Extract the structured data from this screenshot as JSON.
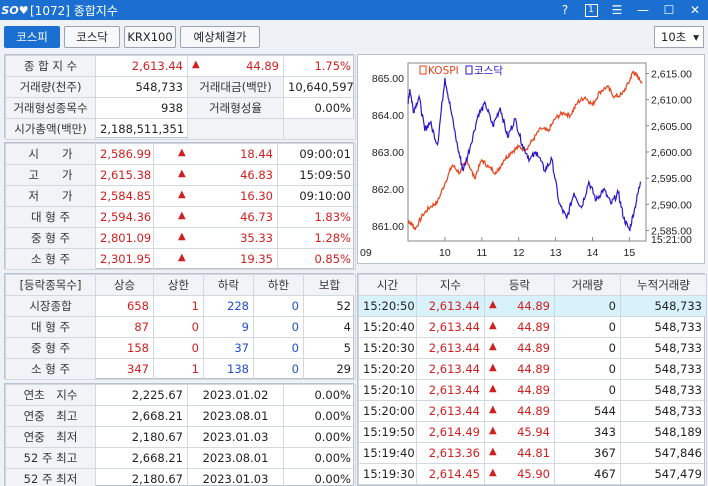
{
  "window": {
    "logo": "SO♥",
    "title": "[1072] 종합지수",
    "help": "?",
    "num_btn": "1",
    "menu": "☰",
    "minimize": "—",
    "maximize": "☐",
    "close": "✕"
  },
  "tabs": [
    "코스피",
    "코스닥",
    "KRX100",
    "예상체결가"
  ],
  "interval": "10초",
  "summary": {
    "index_label": "종 합 지 수",
    "index_value": "2,613.44",
    "index_change": "44.89",
    "index_rate": "1.75%",
    "volume_label": "거래량(천주)",
    "volume": "548,733",
    "amount_label": "거래대금(백만)",
    "amount": "10,640,597",
    "formed_count_label": "거래형성종목수",
    "formed_count": "938",
    "formed_rate_label": "거래형성율",
    "formed_rate": "0.00%",
    "mktcap_label": "시가총액(백만)",
    "mktcap": "2,188,511,351"
  },
  "prices": [
    {
      "label": "시　　가",
      "value": "2,586.99",
      "change": "18.44",
      "extra": "09:00:01",
      "extra_red": false
    },
    {
      "label": "고　　가",
      "value": "2,615.38",
      "change": "46.83",
      "extra": "15:09:50",
      "extra_red": false
    },
    {
      "label": "저　　가",
      "value": "2,584.85",
      "change": "16.30",
      "extra": "09:10:00",
      "extra_red": false
    },
    {
      "label": "대 형 주",
      "value": "2,594.36",
      "change": "46.73",
      "extra": "1.83%",
      "extra_red": true
    },
    {
      "label": "중 형 주",
      "value": "2,801.09",
      "change": "35.33",
      "extra": "1.28%",
      "extra_red": true
    },
    {
      "label": "소 형 주",
      "value": "2,301.95",
      "change": "19.35",
      "extra": "0.85%",
      "extra_red": true
    }
  ],
  "updown": {
    "headers": [
      "[등락종목수]",
      "상승",
      "상한",
      "하락",
      "하한",
      "보합"
    ],
    "rows": [
      {
        "label": "시장종합",
        "up": "658",
        "upper": "1",
        "down": "228",
        "lower": "0",
        "flat": "52"
      },
      {
        "label": "대 형 주",
        "up": "87",
        "upper": "0",
        "down": "9",
        "lower": "0",
        "flat": "4"
      },
      {
        "label": "중 형 주",
        "up": "158",
        "upper": "0",
        "down": "37",
        "lower": "0",
        "flat": "5"
      },
      {
        "label": "소 형 주",
        "up": "347",
        "upper": "1",
        "down": "138",
        "lower": "0",
        "flat": "29"
      }
    ]
  },
  "yearly": [
    {
      "label": "연초　지수",
      "value": "2,225.67",
      "date": "2023.01.02",
      "rate": "0.00%"
    },
    {
      "label": "연중　최고",
      "value": "2,668.21",
      "date": "2023.08.01",
      "rate": "0.00%"
    },
    {
      "label": "연중　최저",
      "value": "2,180.67",
      "date": "2023.01.03",
      "rate": "0.00%"
    },
    {
      "label": "52 주 최고",
      "value": "2,668.21",
      "date": "2023.08.01",
      "rate": "0.00%"
    },
    {
      "label": "52 주 최저",
      "value": "2,180.67",
      "date": "2023.01.03",
      "rate": "0.00%"
    }
  ],
  "ticks": {
    "headers": [
      "시간",
      "지수",
      "등락",
      "거래량",
      "누적거래량"
    ],
    "rows": [
      {
        "time": "15:20:50",
        "index": "2,613.44",
        "change": "44.89",
        "vol": "0",
        "cum": "548,733"
      },
      {
        "time": "15:20:40",
        "index": "2,613.44",
        "change": "44.89",
        "vol": "0",
        "cum": "548,733"
      },
      {
        "time": "15:20:30",
        "index": "2,613.44",
        "change": "44.89",
        "vol": "0",
        "cum": "548,733"
      },
      {
        "time": "15:20:20",
        "index": "2,613.44",
        "change": "44.89",
        "vol": "0",
        "cum": "548,733"
      },
      {
        "time": "15:20:10",
        "index": "2,613.44",
        "change": "44.89",
        "vol": "0",
        "cum": "548,733"
      },
      {
        "time": "15:20:00",
        "index": "2,613.44",
        "change": "44.89",
        "vol": "544",
        "cum": "548,733"
      },
      {
        "time": "15:19:50",
        "index": "2,614.49",
        "change": "45.94",
        "vol": "343",
        "cum": "548,189"
      },
      {
        "time": "15:19:40",
        "index": "2,613.36",
        "change": "44.81",
        "vol": "367",
        "cum": "547,846"
      },
      {
        "time": "15:19:30",
        "index": "2,614.45",
        "change": "45.90",
        "vol": "467",
        "cum": "547,479"
      }
    ]
  },
  "chart_data": {
    "type": "line",
    "legend": [
      "KOSPI",
      "코스닥"
    ],
    "legend_colors": [
      "#e8421a",
      "#2a17c9"
    ],
    "x_ticks": [
      "09",
      "10",
      "11",
      "12",
      "13",
      "14",
      "15"
    ],
    "x_end_label": "15:21:00",
    "left_axis": {
      "ticks": [
        "865.00",
        "864.00",
        "863.00",
        "862.00",
        "861.00"
      ],
      "ylim": [
        860.6,
        865.4
      ]
    },
    "right_axis": {
      "ticks": [
        "2,615.00",
        "2,610.00",
        "2,605.00",
        "2,600.00",
        "2,595.00",
        "2,590.00",
        "2,585.00"
      ],
      "ylim": [
        2583.0,
        2617.0
      ]
    },
    "series": [
      {
        "name": "KOSPI",
        "axis": "right",
        "color": "#e8421a",
        "x": [
          9.0,
          9.1,
          9.2,
          9.4,
          9.6,
          9.8,
          10.0,
          10.2,
          10.4,
          10.6,
          10.8,
          11.0,
          11.2,
          11.4,
          11.6,
          11.8,
          12.0,
          12.2,
          12.4,
          12.6,
          12.8,
          13.0,
          13.2,
          13.4,
          13.6,
          13.8,
          14.0,
          14.2,
          14.4,
          14.6,
          14.8,
          15.0,
          15.1,
          15.2,
          15.35
        ],
        "values": [
          2587.0,
          2586.2,
          2585.3,
          2588.0,
          2589.5,
          2590.5,
          2594.0,
          2597.5,
          2596.0,
          2598.5,
          2595.0,
          2598.5,
          2597.0,
          2596.0,
          2598.5,
          2600.0,
          2601.0,
          2600.5,
          2602.5,
          2604.5,
          2604.0,
          2606.5,
          2607.5,
          2607.0,
          2609.5,
          2610.5,
          2609.0,
          2611.5,
          2612.5,
          2610.5,
          2611.0,
          2613.5,
          2615.4,
          2614.5,
          2613.4
        ]
      },
      {
        "name": "코스닥",
        "axis": "left",
        "color": "#2a17c9",
        "x": [
          9.0,
          9.05,
          9.15,
          9.3,
          9.45,
          9.6,
          9.8,
          10.0,
          10.15,
          10.35,
          10.5,
          10.7,
          10.9,
          11.1,
          11.3,
          11.5,
          11.7,
          11.9,
          12.1,
          12.3,
          12.5,
          12.7,
          12.9,
          13.1,
          13.3,
          13.5,
          13.7,
          13.9,
          14.1,
          14.3,
          14.5,
          14.7,
          14.85,
          15.0,
          15.15,
          15.3
        ],
        "values": [
          864.3,
          864.7,
          864.1,
          864.5,
          863.6,
          863.8,
          863.2,
          865.0,
          864.2,
          863.1,
          862.5,
          863.2,
          864.0,
          864.3,
          863.7,
          864.2,
          863.4,
          863.9,
          863.2,
          862.8,
          863.0,
          862.5,
          862.8,
          861.6,
          861.2,
          861.9,
          861.5,
          862.2,
          861.7,
          862.0,
          861.6,
          861.9,
          861.2,
          860.9,
          861.5,
          862.2
        ]
      }
    ]
  }
}
